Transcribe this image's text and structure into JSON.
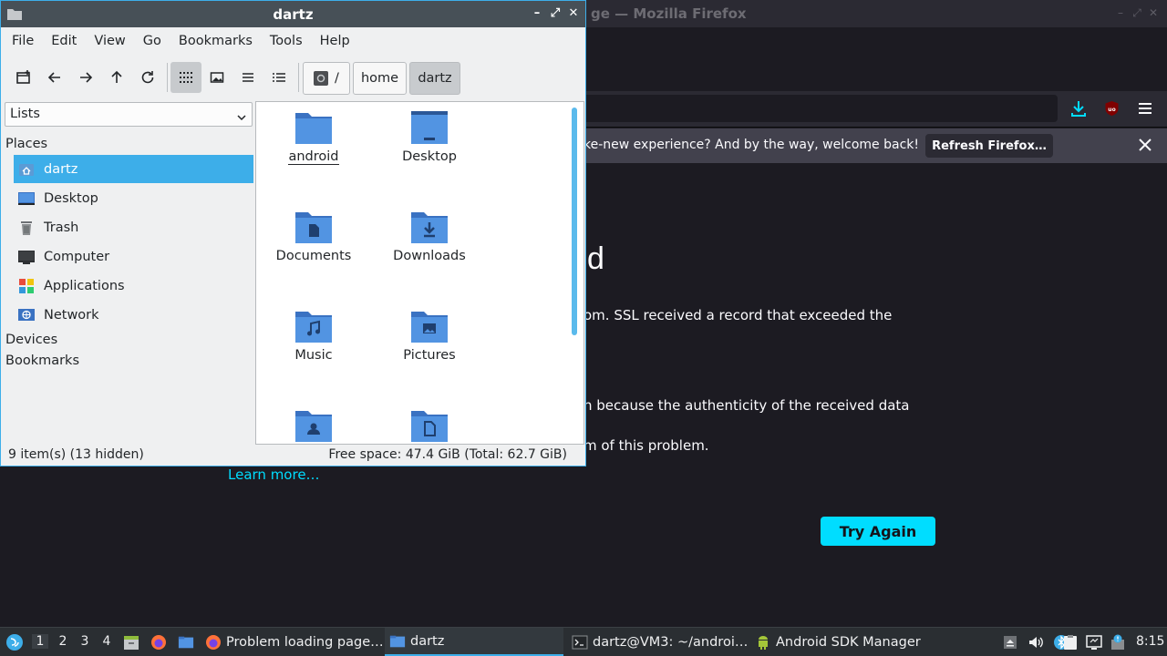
{
  "firefox": {
    "title": "ge — Mozilla Firefox",
    "notification": "ke-new experience? And by the way, welcome back!",
    "refresh_label": "Refresh Firefox…",
    "heading": "d",
    "para1": "om. SSL received a record that exceeded the",
    "para2": "n because the authenticity of the received data",
    "para3": "m of this problem.",
    "learn_more": "Learn more…",
    "try_again": "Try Again"
  },
  "fm": {
    "title": "dartz",
    "menu": [
      "File",
      "Edit",
      "View",
      "Go",
      "Bookmarks",
      "Tools",
      "Help"
    ],
    "breadcrumbs": [
      "/",
      "home",
      "dartz"
    ],
    "side_mode": "Lists",
    "places_heading": "Places",
    "places": [
      {
        "label": "dartz",
        "icon": "home-icon"
      },
      {
        "label": "Desktop",
        "icon": "desktop-icon"
      },
      {
        "label": "Trash",
        "icon": "trash-icon"
      },
      {
        "label": "Computer",
        "icon": "computer-icon"
      },
      {
        "label": "Applications",
        "icon": "applications-icon"
      },
      {
        "label": "Network",
        "icon": "network-icon"
      }
    ],
    "devices_heading": "Devices",
    "bookmarks_heading": "Bookmarks",
    "files": [
      {
        "label": "android",
        "icon": "folder-icon"
      },
      {
        "label": "Desktop",
        "icon": "folder-desktop-icon"
      },
      {
        "label": "Documents",
        "icon": "folder-documents-icon"
      },
      {
        "label": "Downloads",
        "icon": "folder-downloads-icon"
      },
      {
        "label": "Music",
        "icon": "folder-music-icon"
      },
      {
        "label": "Pictures",
        "icon": "folder-pictures-icon"
      },
      {
        "label": "",
        "icon": "folder-public-icon"
      },
      {
        "label": "",
        "icon": "folder-templates-icon"
      }
    ],
    "status_left": "9 item(s) (13 hidden)",
    "status_right": "Free space: 47.4 GiB (Total: 62.7 GiB)"
  },
  "taskbar": {
    "workspaces": [
      "1",
      "2",
      "3",
      "4"
    ],
    "tasks": [
      {
        "label": "Problem loading page…",
        "icon": "firefox-icon"
      },
      {
        "label": "dartz",
        "icon": "folder-icon"
      },
      {
        "label": "dartz@VM3: ~/androi…",
        "icon": "terminal-icon"
      },
      {
        "label": "Android SDK Manager",
        "icon": "android-icon"
      }
    ],
    "clock": "8:15"
  },
  "colors": {
    "accent": "#3daee9",
    "folder": "#5294e2",
    "firefox_button": "#00ddff"
  }
}
